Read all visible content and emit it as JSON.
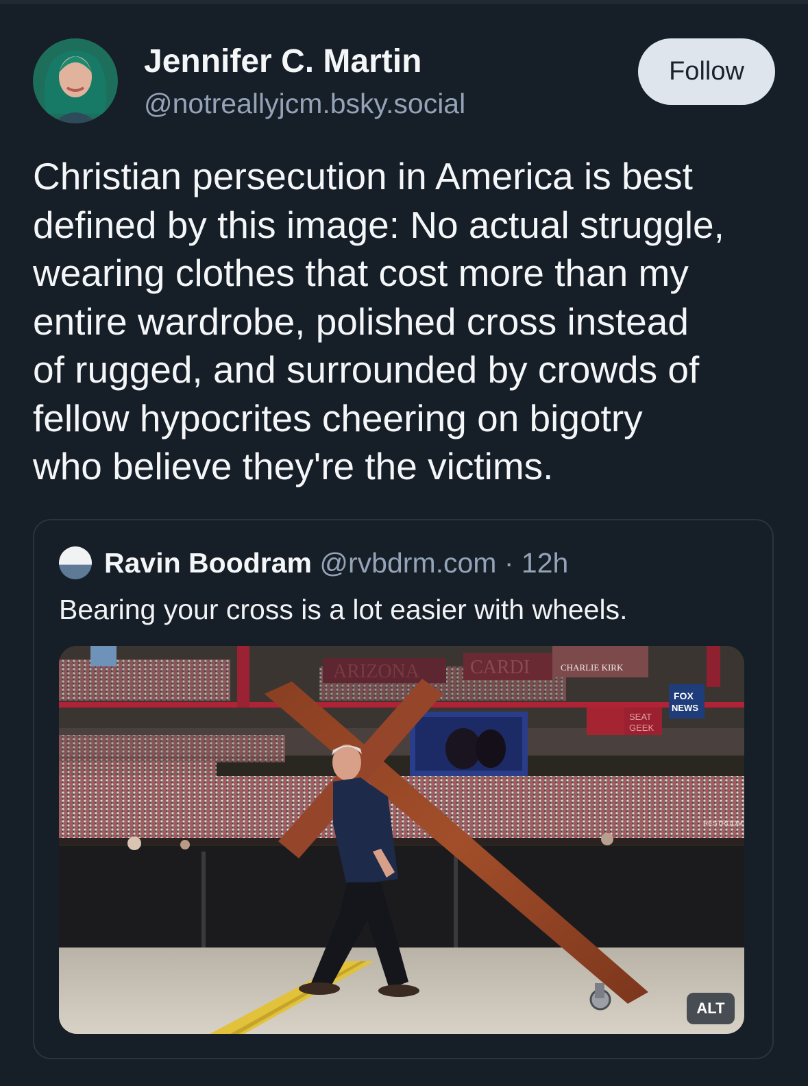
{
  "post": {
    "author_name": "Jennifer C. Martin",
    "author_handle": "@notreallyjcm.bsky.social",
    "follow_label": "Follow",
    "text": "Christian persecution in America is best\ndefined by this image: No actual struggle,\nwearing clothes that cost more than my\nentire wardrobe, polished cross instead\nof rugged, and surrounded by crowds of\nfellow hypocrites cheering on bigotry\nwho believe they're the victims."
  },
  "quote": {
    "author_name": "Ravin Boodram",
    "author_handle": "@rvbdrm.com",
    "separator": " · ",
    "time": "12h",
    "text": "Bearing your cross is a lot easier with wheels.",
    "image": {
      "alt_label": "ALT",
      "signage": {
        "arizona": "ARIZONA",
        "cardinals": "CARDI",
        "banner": "CHARLIE KIRK",
        "seatgeek_1": "SEAT",
        "seatgeek_2": "GEEK",
        "fox_1": "FOX",
        "fox_2": "NEWS",
        "restroom": "RESTROOM"
      }
    }
  },
  "colors": {
    "background": "#161e27",
    "follow_bg": "#dfe5ec",
    "muted_text": "#94a3b8",
    "card_border": "#2a3440"
  }
}
